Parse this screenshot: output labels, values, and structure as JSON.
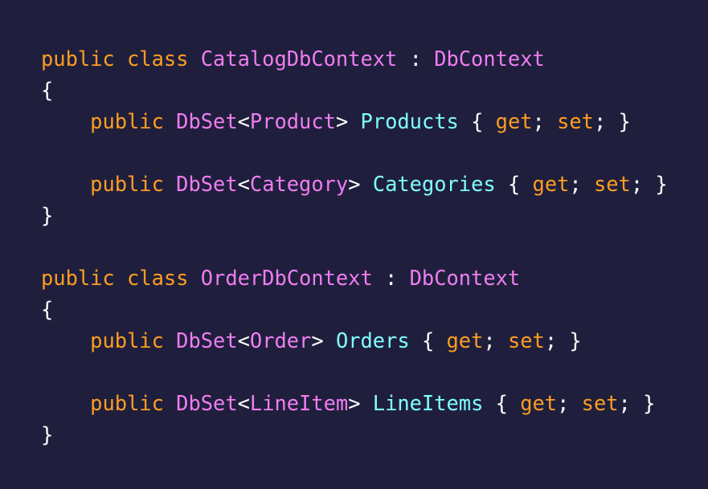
{
  "colors": {
    "background": "#1f1f3d",
    "keyword": "#ff9d22",
    "type": "#f07df0",
    "property": "#80ffff",
    "punctuation": "#ffffff"
  },
  "code": {
    "lines": [
      [
        {
          "t": "public",
          "c": "kw"
        },
        {
          "t": " ",
          "c": "punc"
        },
        {
          "t": "class",
          "c": "kw"
        },
        {
          "t": " ",
          "c": "punc"
        },
        {
          "t": "CatalogDbContext",
          "c": "type"
        },
        {
          "t": " : ",
          "c": "punc"
        },
        {
          "t": "DbContext",
          "c": "type"
        }
      ],
      [
        {
          "t": "{",
          "c": "punc"
        }
      ],
      [
        {
          "t": "    ",
          "c": "punc"
        },
        {
          "t": "public",
          "c": "kw"
        },
        {
          "t": " ",
          "c": "punc"
        },
        {
          "t": "DbSet",
          "c": "type"
        },
        {
          "t": "<",
          "c": "punc"
        },
        {
          "t": "Product",
          "c": "type"
        },
        {
          "t": ">",
          "c": "punc"
        },
        {
          "t": " ",
          "c": "punc"
        },
        {
          "t": "Products",
          "c": "prop"
        },
        {
          "t": " { ",
          "c": "punc"
        },
        {
          "t": "get",
          "c": "kw"
        },
        {
          "t": "; ",
          "c": "punc"
        },
        {
          "t": "set",
          "c": "kw"
        },
        {
          "t": "; }",
          "c": "punc"
        }
      ],
      [],
      [
        {
          "t": "    ",
          "c": "punc"
        },
        {
          "t": "public",
          "c": "kw"
        },
        {
          "t": " ",
          "c": "punc"
        },
        {
          "t": "DbSet",
          "c": "type"
        },
        {
          "t": "<",
          "c": "punc"
        },
        {
          "t": "Category",
          "c": "type"
        },
        {
          "t": ">",
          "c": "punc"
        },
        {
          "t": " ",
          "c": "punc"
        },
        {
          "t": "Categories",
          "c": "prop"
        },
        {
          "t": " { ",
          "c": "punc"
        },
        {
          "t": "get",
          "c": "kw"
        },
        {
          "t": "; ",
          "c": "punc"
        },
        {
          "t": "set",
          "c": "kw"
        },
        {
          "t": "; }",
          "c": "punc"
        }
      ],
      [
        {
          "t": "}",
          "c": "punc"
        }
      ],
      [],
      [
        {
          "t": "public",
          "c": "kw"
        },
        {
          "t": " ",
          "c": "punc"
        },
        {
          "t": "class",
          "c": "kw"
        },
        {
          "t": " ",
          "c": "punc"
        },
        {
          "t": "OrderDbContext",
          "c": "type"
        },
        {
          "t": " : ",
          "c": "punc"
        },
        {
          "t": "DbContext",
          "c": "type"
        }
      ],
      [
        {
          "t": "{",
          "c": "punc"
        }
      ],
      [
        {
          "t": "    ",
          "c": "punc"
        },
        {
          "t": "public",
          "c": "kw"
        },
        {
          "t": " ",
          "c": "punc"
        },
        {
          "t": "DbSet",
          "c": "type"
        },
        {
          "t": "<",
          "c": "punc"
        },
        {
          "t": "Order",
          "c": "type"
        },
        {
          "t": ">",
          "c": "punc"
        },
        {
          "t": " ",
          "c": "punc"
        },
        {
          "t": "Orders",
          "c": "prop"
        },
        {
          "t": " { ",
          "c": "punc"
        },
        {
          "t": "get",
          "c": "kw"
        },
        {
          "t": "; ",
          "c": "punc"
        },
        {
          "t": "set",
          "c": "kw"
        },
        {
          "t": "; }",
          "c": "punc"
        }
      ],
      [],
      [
        {
          "t": "    ",
          "c": "punc"
        },
        {
          "t": "public",
          "c": "kw"
        },
        {
          "t": " ",
          "c": "punc"
        },
        {
          "t": "DbSet",
          "c": "type"
        },
        {
          "t": "<",
          "c": "punc"
        },
        {
          "t": "LineItem",
          "c": "type"
        },
        {
          "t": ">",
          "c": "punc"
        },
        {
          "t": " ",
          "c": "punc"
        },
        {
          "t": "LineItems",
          "c": "prop"
        },
        {
          "t": " { ",
          "c": "punc"
        },
        {
          "t": "get",
          "c": "kw"
        },
        {
          "t": "; ",
          "c": "punc"
        },
        {
          "t": "set",
          "c": "kw"
        },
        {
          "t": "; }",
          "c": "punc"
        }
      ],
      [
        {
          "t": "}",
          "c": "punc"
        }
      ]
    ]
  }
}
